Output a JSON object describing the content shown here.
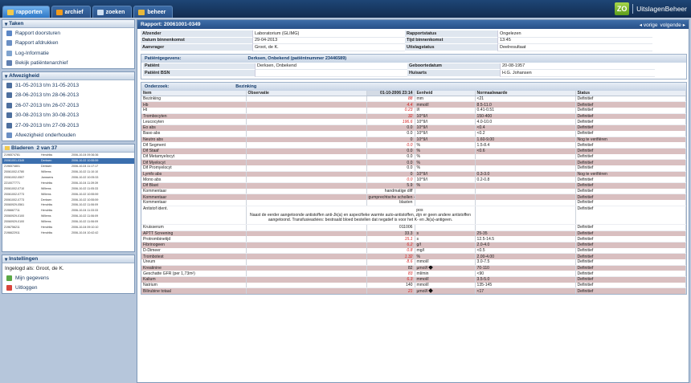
{
  "tabs": [
    {
      "label": "rapporten",
      "active": true,
      "icon": "folder-icon",
      "color": "#f2c94c"
    },
    {
      "label": "archief",
      "active": false,
      "icon": "archive-icon",
      "color": "#f29b1c"
    },
    {
      "label": "zoeken",
      "active": false,
      "icon": "search-icon",
      "color": "#cfe0f2"
    },
    {
      "label": "beheer",
      "active": false,
      "icon": "lock-icon",
      "color": "#e8b83a"
    }
  ],
  "brand": {
    "logo": "ZO",
    "name": "UitslagenBeheer"
  },
  "taken": {
    "title": "Taken",
    "items": [
      "Rapport doorsturen",
      "Rapport afdrukken",
      "Log-Informatie",
      "Bekijk patiëntenarchief"
    ]
  },
  "afwezigheid": {
    "title": "Afwezigheid",
    "items": [
      "31-05-2013 t/m 31-05-2013",
      "28-06-2013 t/m 28-06-2013",
      "26-07-2013 t/m 26-07-2013",
      "30-08-2013 t/m 30-08-2013",
      "27-09-2013 t/m 27-09-2013"
    ],
    "link": "Afwezigheid onderhouden"
  },
  "bladeren": {
    "title": "Bladeren",
    "counter": "2 van 37",
    "rows": [
      [
        "2196574781",
        "Hendriks",
        "2006-10-04 09:36:36"
      ],
      [
        "20061001-0349",
        "Derksen",
        "2006-10-02 10:55:59"
      ],
      [
        "2196574801",
        "Derksen",
        "2006-10-04 11:17:17"
      ],
      [
        "20061002-0780",
        "Willems",
        "2006-10-02 11:10:10"
      ],
      [
        "20061002-0507",
        "Janssens",
        "2006-10-02 10:05:33"
      ],
      [
        "2210077771",
        "Hendriks",
        "2006-10-04 11:39:39"
      ],
      [
        "20061002-0710",
        "Willems",
        "2006-10-02 11:05:33"
      ],
      [
        "20061002-0773",
        "Willems",
        "2006-10-02 10:55:59"
      ],
      [
        "20061002-0773",
        "Derksen",
        "2006-10-02 10:55:59"
      ],
      [
        "20060929-0561",
        "Hendriks",
        "2006-10-02 11:06:09"
      ],
      [
        "2196667711",
        "Hendriks",
        "2006-10-04 11:33:33"
      ],
      [
        "20060929-0100",
        "Willems",
        "2006-10-02 11:06:09"
      ],
      [
        "20060929-0100",
        "Willems",
        "2006-10-02 11:06:09"
      ],
      [
        "2196756211",
        "Hendriks",
        "2006-10-04 09:10:10"
      ],
      [
        "2196622911",
        "Hendriks",
        "2006-10-04 10:42:42"
      ]
    ]
  },
  "instellingen": {
    "title": "Instellingen",
    "logged_in": "Ingelogd als: Groot, de K.",
    "items": [
      "Mijn gegevens",
      "Uitloggen"
    ]
  },
  "report": {
    "title": "Rapport: 20061001-0349",
    "nav_prev": "vorige",
    "nav_next": "volgende",
    "meta": [
      [
        "Afzender",
        "Laboratorium (GLIMG)",
        "Rapportstatus",
        "Ongelezen"
      ],
      [
        "Datum binnenkomst",
        "29-04-2013",
        "Tijd binnenkomst",
        "13:45"
      ],
      [
        "Aanvrager",
        "Groot, de K.",
        "Uitslagstatus",
        "Deelresultaat"
      ]
    ],
    "patient_header": "Patiëntgegevens:",
    "patient_name": "Derksen, Onbekend (patiëntnummer 23446589)",
    "patient": [
      [
        "Patiënt",
        "Derksen, Onbekend",
        "Geboortedatum",
        "20-08-1957"
      ],
      [
        "Patiënt BSN",
        "",
        "Huisarts",
        "H.G. Johansen"
      ]
    ],
    "onderzoek_label": "Onderzoek:",
    "onderzoek": "Bezinking",
    "columns": [
      "Item",
      "Observatie",
      "01-10-2006 23:14",
      "Eenheid",
      "Normaalwaarde",
      "Status"
    ],
    "rows": [
      [
        "Bezinking",
        "",
        "88",
        "mm",
        "<21",
        "Definitief",
        0,
        1,
        0
      ],
      [
        "Hb",
        "",
        "4.4",
        "mmol/l",
        "8.5-11.0",
        "Definitief",
        1,
        1,
        0
      ],
      [
        "Ht",
        "",
        "0.23",
        "l/l",
        "0.41-0.51",
        "Definitief",
        0,
        1,
        0
      ],
      [
        "Trombocyten",
        "",
        "32",
        "10^9/l",
        "150-400",
        "Definitief",
        1,
        1,
        0
      ],
      [
        "Leucocyten",
        "",
        "196.6",
        "10^9/l",
        "4.0-10.0",
        "Definitief",
        0,
        1,
        0
      ],
      [
        "Eo abs",
        "",
        "0.0",
        "10^9/l",
        "<0.4",
        "Definitief",
        1,
        0,
        0
      ],
      [
        "Baso abs",
        "",
        "0.0",
        "10^9/l",
        "<0.2",
        "Definitief",
        0,
        0,
        0
      ],
      [
        "Neutro abs",
        "",
        "0",
        "10^9/l",
        "1.60-9.00",
        "Nog te verifiëren",
        1,
        0,
        0
      ],
      [
        "Dif Segment",
        "",
        "0.0",
        "%",
        "1.5-8.4",
        "Definitief",
        0,
        1,
        0
      ],
      [
        "Dif Staaf",
        "",
        "0.0",
        "%",
        "<0.6",
        "Definitief",
        1,
        0,
        0
      ],
      [
        "Dif Metamyelocyt",
        "",
        "0.0",
        "%",
        "",
        "Definitief",
        0,
        0,
        0
      ],
      [
        "Dif Myelocyt",
        "",
        "0.0",
        "%",
        "",
        "Definitief",
        1,
        0,
        0
      ],
      [
        "Dif Promyelocyt",
        "",
        "0.0",
        "%",
        "",
        "Definitief",
        0,
        0,
        0
      ],
      [
        "Lymfo abs",
        "",
        "0",
        "10^9/l",
        "0.3-3.0",
        "Nog te verifiëren",
        1,
        0,
        0
      ],
      [
        "Mono abs",
        "",
        "0.0",
        "10^9/l",
        "0.2-0.8",
        "Definitief",
        0,
        1,
        0
      ],
      [
        "Dif Blast",
        "",
        "5.9",
        "%",
        "",
        "Definitief",
        1,
        0,
        0
      ],
      [
        "Kommentaar",
        "",
        "handmatige diff",
        "",
        "",
        "Definitief",
        0,
        0,
        0
      ],
      [
        "Kommentaar",
        "",
        "gumprechtsche schollen +++",
        "",
        "",
        "Definitief",
        1,
        0,
        0
      ],
      [
        "Kommentaar",
        "",
        "blasten",
        "",
        "",
        "Definitief",
        0,
        0,
        0
      ]
    ],
    "antistof": {
      "item": "Antistof ident.",
      "value": "pos",
      "note": "Naast de eerder aangetoonde antistoffen anti-Jk(a) en aspecifieke warmte auto-antistoffen, zijn er geen andere antistoffen aangetoond. Transfusieadvies: bestraald bloed bestellen dat negatief is voor het K- en Jk(a)-antigeen.",
      "status": "Definitief"
    },
    "rows2": [
      [
        "Kruisserum",
        "",
        "011006",
        "",
        "",
        "Definitief",
        0,
        0,
        0
      ],
      [
        "APTT Screening",
        "",
        "33.3",
        "s",
        "25-35",
        "Definitief",
        1,
        0,
        0
      ],
      [
        "Protrombinetijd",
        "",
        "15.1",
        "s",
        "12.5-14.5",
        "Definitief",
        0,
        1,
        0
      ],
      [
        "Fibrinogeen",
        "",
        "6.2",
        "g/l",
        "2.0-4.0",
        "Definitief",
        1,
        1,
        0
      ],
      [
        "D-Dimeer",
        "",
        "0.8",
        "mg/l",
        "<0.5",
        "Definitief",
        0,
        1,
        0
      ],
      [
        "Trombotest",
        "",
        "1.32",
        "%",
        "2.00-4.00",
        "Definitief",
        1,
        1,
        0
      ],
      [
        "Ureum",
        "",
        "8.6",
        "mmol/l",
        "3.0-7.5",
        "Definitief",
        0,
        1,
        0
      ],
      [
        "Kreatinine",
        "",
        "82",
        "µmol/l",
        "70-110",
        "Definitief",
        1,
        0,
        1
      ],
      [
        "Geschatte GFR (per 1,73m²)",
        "",
        "83",
        "ml/min",
        "<90",
        "Definitief",
        0,
        1,
        0
      ],
      [
        "Kalium",
        "",
        "6.3",
        "mmol/l",
        "3.5-5.0",
        "Definitief",
        1,
        1,
        0
      ],
      [
        "Natrium",
        "",
        "140",
        "mmol/l",
        "135-145",
        "Definitief",
        0,
        0,
        0
      ],
      [
        "Bilirubine totaal",
        "",
        "21",
        "µmol/l",
        "<17",
        "Definitief",
        1,
        1,
        1
      ]
    ]
  }
}
